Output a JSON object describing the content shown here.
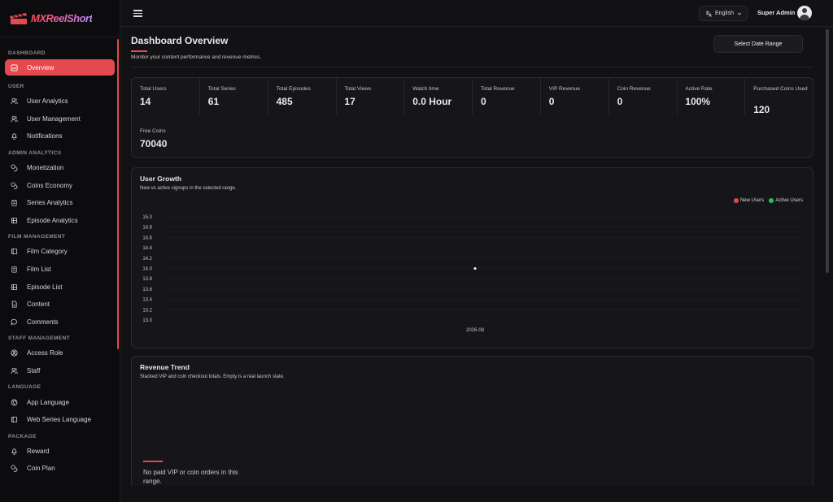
{
  "brand": {
    "name": "MXReelShort",
    "accent": "#e5484d"
  },
  "sidebar": {
    "sections": [
      {
        "title": "DASHBOARD",
        "items": [
          {
            "label": "Overview",
            "icon": "chart-icon",
            "active": true
          }
        ]
      },
      {
        "title": "USER",
        "items": [
          {
            "label": "User Analytics",
            "icon": "users-icon"
          },
          {
            "label": "User Management",
            "icon": "users-icon"
          },
          {
            "label": "Notifications",
            "icon": "bell-icon"
          }
        ]
      },
      {
        "title": "ADMIN ANALYTICS",
        "items": [
          {
            "label": "Monetization",
            "icon": "coins-icon"
          },
          {
            "label": "Coins Economy",
            "icon": "coins-icon"
          },
          {
            "label": "Series Analytics",
            "icon": "clipboard-icon"
          },
          {
            "label": "Episode Analytics",
            "icon": "film-icon"
          }
        ]
      },
      {
        "title": "FILM MANAGEMENT",
        "items": [
          {
            "label": "Film Category",
            "icon": "book-icon"
          },
          {
            "label": "Film List",
            "icon": "clipboard-icon"
          },
          {
            "label": "Episode List",
            "icon": "film-icon"
          },
          {
            "label": "Content",
            "icon": "file-icon"
          },
          {
            "label": "Comments",
            "icon": "comment-icon"
          }
        ]
      },
      {
        "title": "STAFF MANAGEMENT",
        "items": [
          {
            "label": "Access Role",
            "icon": "user-circle-icon"
          },
          {
            "label": "Staff",
            "icon": "users-icon"
          }
        ]
      },
      {
        "title": "LANGUAGE",
        "items": [
          {
            "label": "App Language",
            "icon": "globe-icon"
          },
          {
            "label": "Web Series Language",
            "icon": "book-icon"
          }
        ]
      },
      {
        "title": "PACKAGE",
        "items": [
          {
            "label": "Reward",
            "icon": "bell-icon"
          },
          {
            "label": "Coin Plan",
            "icon": "coins-icon"
          }
        ]
      }
    ]
  },
  "topbar": {
    "language": "English",
    "user": "Super Admin"
  },
  "header": {
    "title": "Dashboard Overview",
    "subtitle": "Monitor your content performance and revenue metrics.",
    "date_button": "Select Date Range"
  },
  "stats": [
    {
      "label": "Total Users",
      "value": "14"
    },
    {
      "label": "Total Series",
      "value": "61"
    },
    {
      "label": "Total Episodes",
      "value": "485"
    },
    {
      "label": "Total Views",
      "value": "17"
    },
    {
      "label": "Watch time",
      "value": "0.0 Hour"
    },
    {
      "label": "Total Revenue",
      "value": "0"
    },
    {
      "label": "VIP Revenue",
      "value": "0"
    },
    {
      "label": "Coin Revenue",
      "value": "0"
    },
    {
      "label": "Active Rate",
      "value": "100%"
    },
    {
      "label": "Purchased Coins Used",
      "value": "120"
    },
    {
      "label": "Free Coins",
      "value": "70040"
    }
  ],
  "user_growth": {
    "title": "User Growth",
    "subtitle": "New vs active signups in the selected range.",
    "legend": [
      {
        "name": "New Users",
        "color": "#e5484d"
      },
      {
        "name": "Active Users",
        "color": "#22c55e"
      }
    ]
  },
  "revenue_trend": {
    "title": "Revenue Trend",
    "subtitle": "Stacked VIP and coin checkout totals. Empty is a real launch state.",
    "empty_text": "No paid VIP or coin orders in this range."
  },
  "chart_data": {
    "type": "line",
    "x": [
      "2026-08"
    ],
    "series": [
      {
        "name": "New Users",
        "values": [
          14
        ],
        "color": "#e5484d"
      },
      {
        "name": "Active Users",
        "values": [
          14
        ],
        "color": "#22c55e"
      }
    ],
    "yticks": [
      "15.0",
      "14.8",
      "14.6",
      "14.4",
      "14.2",
      "14.0",
      "13.8",
      "13.6",
      "13.4",
      "13.2",
      "13.0"
    ],
    "ylim": [
      13.0,
      15.0
    ],
    "grid": true,
    "legend": "top-right"
  }
}
